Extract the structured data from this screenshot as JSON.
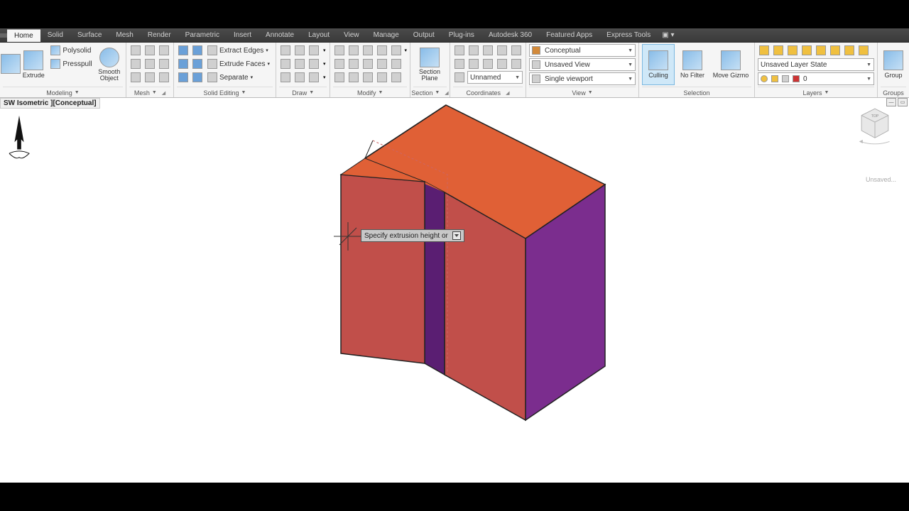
{
  "tabs": [
    "Home",
    "Solid",
    "Surface",
    "Mesh",
    "Render",
    "Parametric",
    "Insert",
    "Annotate",
    "Layout",
    "View",
    "Manage",
    "Output",
    "Plug-ins",
    "Autodesk 360",
    "Featured Apps",
    "Express Tools"
  ],
  "active_tab": "Home",
  "view_label": "SW Isometric ][Conceptual]",
  "tooltip_text": "Specify extrusion height or",
  "nav_hint": "Unsaved...",
  "panels": {
    "modeling": {
      "label": "Modeling",
      "extrude": "Extrude",
      "poly": "Polysolid",
      "press": "Presspull",
      "smooth": "Smooth Object"
    },
    "mesh": {
      "label": "Mesh"
    },
    "solid_edit": {
      "label": "Solid Editing",
      "extract": "Extract Edges",
      "faces": "Extrude Faces",
      "separate": "Separate"
    },
    "draw": {
      "label": "Draw"
    },
    "modify": {
      "label": "Modify"
    },
    "section": {
      "label": "Section",
      "plane": "Section Plane"
    },
    "coords": {
      "label": "Coordinates",
      "unnamed": "Unnamed"
    },
    "view": {
      "label": "View",
      "conceptual": "Conceptual",
      "unsaved": "Unsaved View",
      "viewport": "Single viewport"
    },
    "selection": {
      "label": "Selection",
      "culling": "Culling",
      "nofilter": "No Filter",
      "gizmo": "Move Gizmo"
    },
    "layers": {
      "label": "Layers",
      "state": "Unsaved Layer State",
      "layer0": "0"
    },
    "groups": {
      "label": "Groups",
      "group": "Group"
    }
  }
}
